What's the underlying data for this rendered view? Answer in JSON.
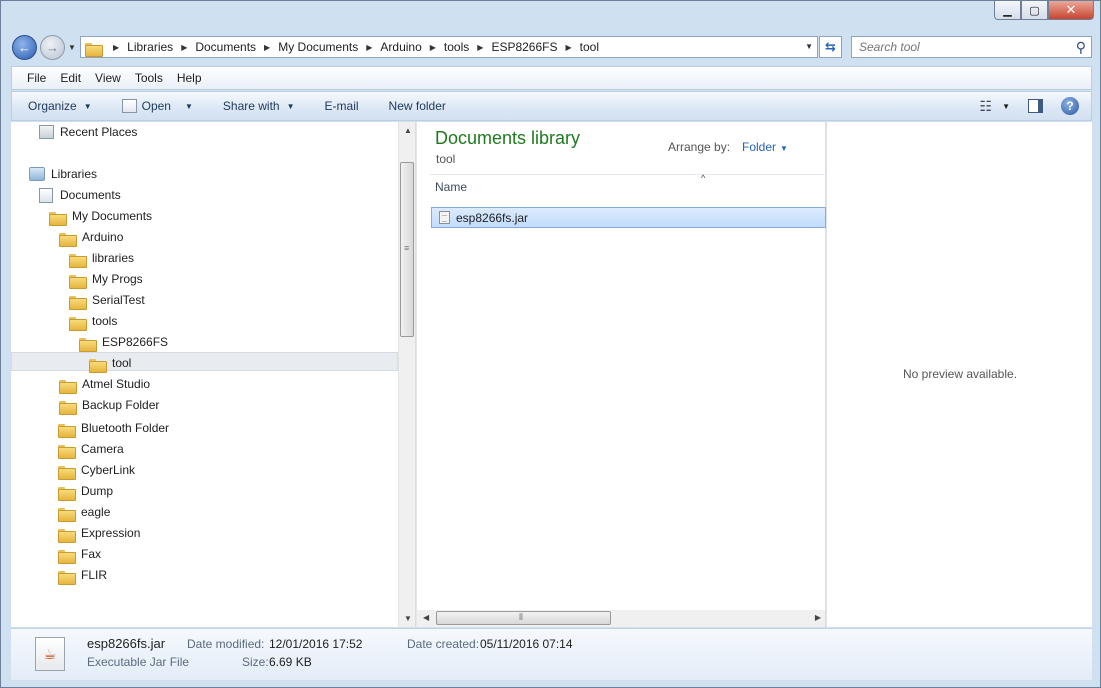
{
  "window": {
    "minimize": "▁",
    "maximize": "▢",
    "close": "✕"
  },
  "address": {
    "crumbs": [
      "Libraries",
      "Documents",
      "My Documents",
      "Arduino",
      "tools",
      "ESP8266FS",
      "tool"
    ]
  },
  "search": {
    "placeholder": "Search tool"
  },
  "menu": {
    "file": "File",
    "edit": "Edit",
    "view": "View",
    "tools": "Tools",
    "help": "Help"
  },
  "toolbar": {
    "organize": "Organize",
    "open": "Open",
    "share_with": "Share with",
    "email": "E-mail",
    "new_folder": "New folder"
  },
  "nav": {
    "recent_places": "Recent Places",
    "libraries": "Libraries",
    "documents": "Documents",
    "my_documents": "My Documents",
    "arduino": "Arduino",
    "libraries_folder": "libraries",
    "my_progs": "My Progs",
    "serial_test": "SerialTest",
    "tools": "tools",
    "esp8266fs": "ESP8266FS",
    "tool": "tool",
    "atmel_studio": "Atmel Studio",
    "backup_folder": "Backup Folder",
    "bluetooth_folder": "Bluetooth Folder",
    "camera": "Camera",
    "cyberlink": "CyberLink",
    "dump": "Dump",
    "eagle": "eagle",
    "expression": "Expression",
    "fax": "Fax",
    "flir": "FLIR"
  },
  "content": {
    "library_title": "Documents library",
    "library_subtitle": "tool",
    "arrange_label": "Arrange by:",
    "arrange_value": "Folder",
    "column_name": "Name",
    "files": [
      {
        "name": "esp8266fs.jar"
      }
    ]
  },
  "preview": {
    "message": "No preview available."
  },
  "details": {
    "filename": "esp8266fs.jar",
    "filetype": "Executable Jar File",
    "modified_label": "Date modified:",
    "modified_value": "12/01/2016 17:52",
    "size_label": "Size:",
    "size_value": "6.69 KB",
    "created_label": "Date created:",
    "created_value": "05/11/2016 07:14"
  }
}
